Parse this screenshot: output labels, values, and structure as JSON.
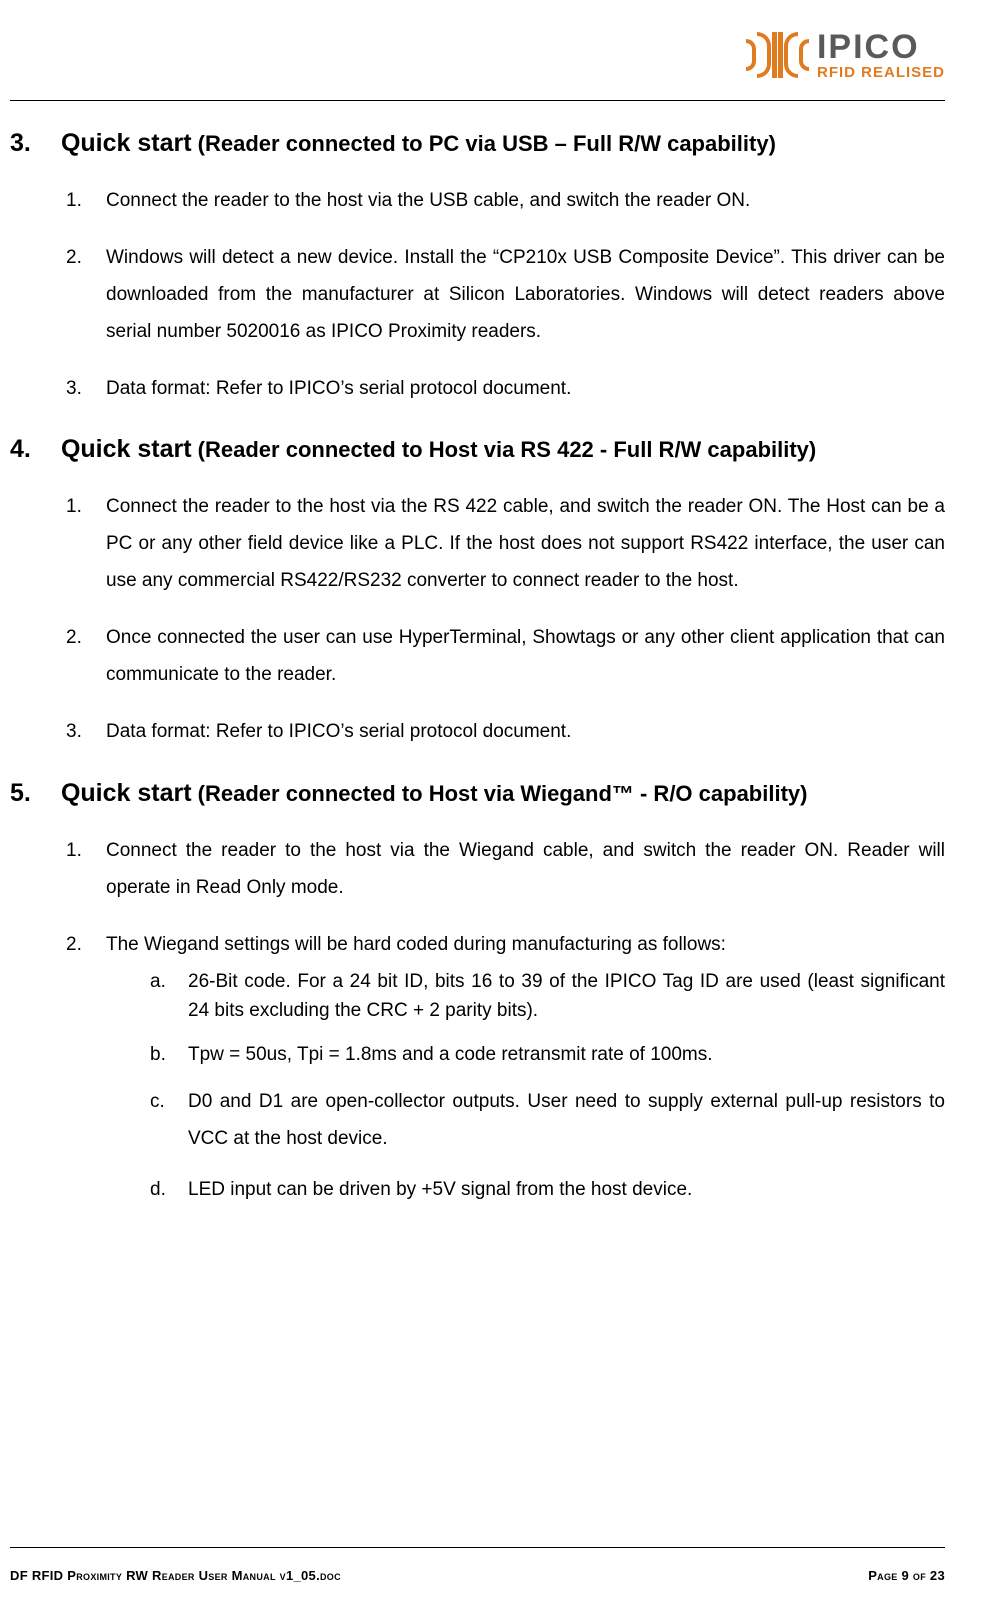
{
  "logo": {
    "brand": "IPICO",
    "tagline": "RFID REALISED"
  },
  "sections": [
    {
      "number": "3.",
      "title_bold": "Quick start",
      "title_sub": " (Reader connected to PC via USB – Full R/W capability)",
      "items": [
        "Connect the reader to the host via the USB cable, and switch the reader ON.",
        "Windows will detect a new device. Install the “CP210x USB Composite Device”. This driver can be downloaded from the manufacturer at Silicon Laboratories.  Windows will detect readers above serial number 5020016 as IPICO Proximity readers.",
        "Data format: Refer to IPICO’s serial protocol document."
      ]
    },
    {
      "number": "4.",
      "title_bold": "Quick start",
      "title_sub": " (Reader connected to Host via RS 422 - Full R/W capability)",
      "items": [
        "Connect the reader to the host via the RS 422 cable, and switch the reader ON. The Host can be a PC or any other field device like a PLC. If the host does not support RS422 interface, the user can use any commercial RS422/RS232 converter to connect reader to the host.",
        "Once connected the user can use HyperTerminal, Showtags or any other client application that can communicate to the reader.",
        "Data format: Refer to IPICO’s serial protocol document."
      ]
    },
    {
      "number": "5.",
      "title_bold": "Quick start",
      "title_sub": " (Reader connected to Host via Wiegand™ - R/O capability)",
      "items": [
        "Connect the reader to the host via the Wiegand cable, and switch the reader ON. Reader will operate in Read Only mode.",
        "The Wiegand settings will be hard coded during manufacturing as follows:"
      ],
      "subitems": [
        "26-Bit code. For a 24 bit ID, bits 16 to 39 of the IPICO Tag ID are used (least significant 24 bits excluding the CRC + 2 parity bits).",
        "Tpw = 50us, Tpi = 1.8ms and a code retransmit rate of 100ms.",
        "D0 and D1 are open-collector outputs. User need to supply external pull-up resistors to VCC at the host device.",
        "LED input can be driven by +5V signal from the host device."
      ]
    }
  ],
  "footer": {
    "left": "DF RFID Proximity RW Reader User Manual v1_05.doc",
    "right": "Page 9 of 23"
  }
}
